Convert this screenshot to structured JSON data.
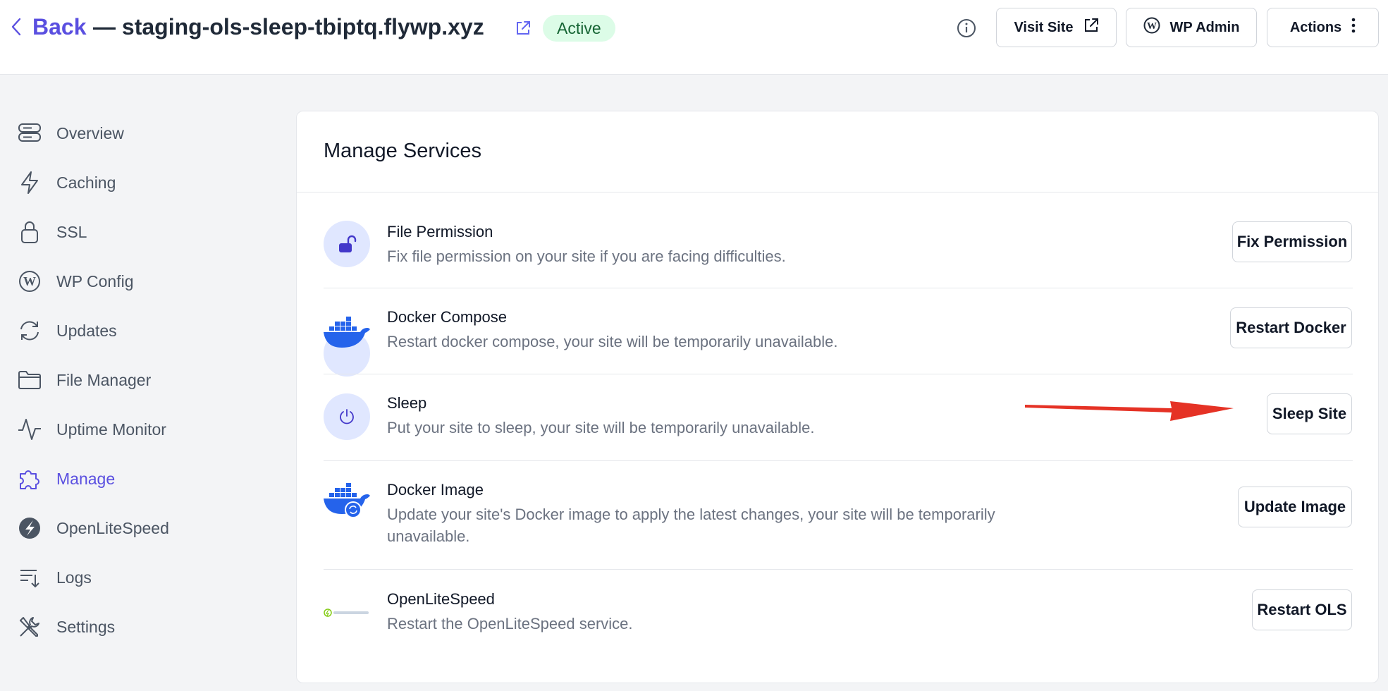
{
  "header": {
    "back_label": "Back",
    "site_title": "— staging-ols-sleep-tbiptq.flywp.xyz",
    "status": "Active",
    "visit_site_label": "Visit Site",
    "wp_admin_label": "WP Admin",
    "actions_label": "Actions"
  },
  "sidebar": {
    "items": [
      {
        "label": "Overview",
        "icon": "server-icon"
      },
      {
        "label": "Caching",
        "icon": "lightning-icon"
      },
      {
        "label": "SSL",
        "icon": "lock-icon"
      },
      {
        "label": "WP Config",
        "icon": "wordpress-icon"
      },
      {
        "label": "Updates",
        "icon": "refresh-icon"
      },
      {
        "label": "File Manager",
        "icon": "folder-icon"
      },
      {
        "label": "Uptime Monitor",
        "icon": "pulse-icon"
      },
      {
        "label": "Manage",
        "icon": "puzzle-icon",
        "active": true
      },
      {
        "label": "OpenLiteSpeed",
        "icon": "openlitespeed-icon"
      },
      {
        "label": "Logs",
        "icon": "logs-icon"
      },
      {
        "label": "Settings",
        "icon": "tools-icon"
      }
    ]
  },
  "main": {
    "title": "Manage Services",
    "services": [
      {
        "title": "File Permission",
        "description": "Fix file permission on your site if you are facing difficulties.",
        "button": "Fix Permission",
        "icon": "unlock-icon"
      },
      {
        "title": "Docker Compose",
        "description": "Restart docker compose, your site will be temporarily unavailable.",
        "button": "Restart Docker",
        "icon": "docker-icon"
      },
      {
        "title": "Sleep",
        "description": "Put your site to sleep, your site will be temporarily unavailable.",
        "button": "Sleep Site",
        "icon": "power-icon"
      },
      {
        "title": "Docker Image",
        "description": "Update your site's Docker image to apply the latest changes, your site will be temporarily unavailable.",
        "button": "Update Image",
        "icon": "docker-refresh-icon"
      },
      {
        "title": "OpenLiteSpeed",
        "description": "Restart the OpenLiteSpeed service.",
        "button": "Restart OLS",
        "icon": "openlitespeed-logo"
      }
    ]
  },
  "colors": {
    "accent": "#5a4fe0",
    "docker": "#2563eb",
    "arrow": "#e53225",
    "badge_bg": "#dcfce7",
    "badge_text": "#166534"
  }
}
